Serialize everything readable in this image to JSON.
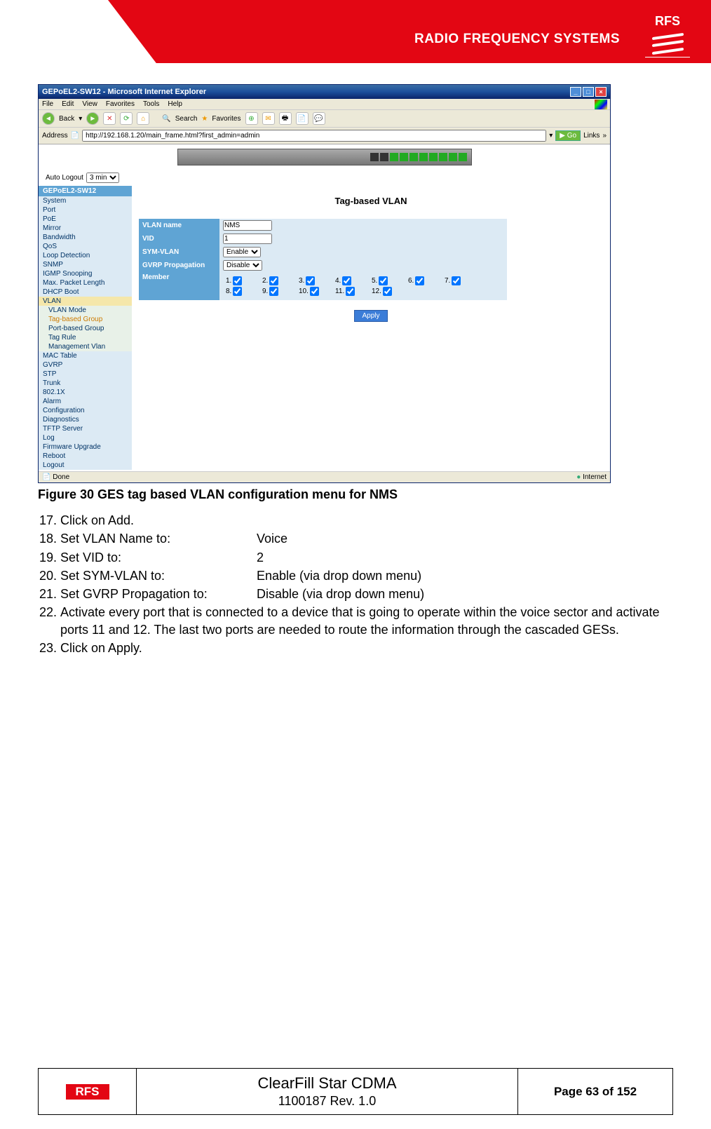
{
  "header": {
    "brand": "RADIO FREQUENCY SYSTEMS",
    "logo_text": "RFS"
  },
  "ie": {
    "title": "GEPoEL2-SW12 - Microsoft Internet Explorer",
    "menu": [
      "File",
      "Edit",
      "View",
      "Favorites",
      "Tools",
      "Help"
    ],
    "back": "Back",
    "search": "Search",
    "favorites_btn": "Favorites",
    "address_label": "Address",
    "url": "http://192.168.1.20/main_frame.html?first_admin=admin",
    "go": "Go",
    "links": "Links",
    "status_left": "Done",
    "status_right": "Internet"
  },
  "app": {
    "auto_logout_label": "Auto Logout",
    "auto_logout_value": "3 min",
    "device_name": "GEPoEL2-SW12",
    "nav": [
      "System",
      "Port",
      "PoE",
      "Mirror",
      "Bandwidth",
      "QoS",
      "Loop Detection",
      "SNMP",
      "IGMP Snooping",
      "Max. Packet Length",
      "DHCP Boot",
      "VLAN"
    ],
    "nav_sub": [
      "VLAN Mode",
      "Tag-based Group",
      "Port-based Group",
      "Tag Rule",
      "Management Vlan"
    ],
    "nav2": [
      "MAC Table",
      "GVRP",
      "STP",
      "Trunk",
      "802.1X",
      "Alarm",
      "Configuration",
      "Diagnostics",
      "TFTP Server",
      "Log",
      "Firmware Upgrade",
      "Reboot",
      "Logout"
    ],
    "main_title": "Tag-based VLAN",
    "fields": {
      "vlan_name_label": "VLAN name",
      "vlan_name_value": "NMS",
      "vid_label": "VID",
      "vid_value": "1",
      "sym_label": "SYM-VLAN",
      "sym_value": "Enable",
      "gvrp_label": "GVRP Propagation",
      "gvrp_value": "Disable",
      "member_label": "Member"
    },
    "members": [
      "1.",
      "2.",
      "3.",
      "4.",
      "5.",
      "6.",
      "7.",
      "8.",
      "9.",
      "10.",
      "11.",
      "12."
    ],
    "apply": "Apply"
  },
  "caption": "Figure 30 GES tag based VLAN configuration menu for NMS",
  "steps": {
    "s17": "Click on Add.",
    "s18k": "Set VLAN Name to:",
    "s18v": "Voice",
    "s19k": "Set VID to:",
    "s19v": "2",
    "s20k": "Set SYM-VLAN to:",
    "s20v": "Enable (via drop down menu)",
    "s21k": "Set GVRP Propagation to:",
    "s21v": "Disable (via drop down menu)",
    "s22": "Activate every port that is connected to a device that is going to operate within the voice sector and activate ports 11 and 12. The last two ports are needed to route the information through the cascaded GESs.",
    "s23": "Click on Apply."
  },
  "footer": {
    "logo": "RFS",
    "title": "ClearFill Star CDMA",
    "rev": "1100187 Rev. 1.0",
    "page": "Page 63 of 152"
  }
}
